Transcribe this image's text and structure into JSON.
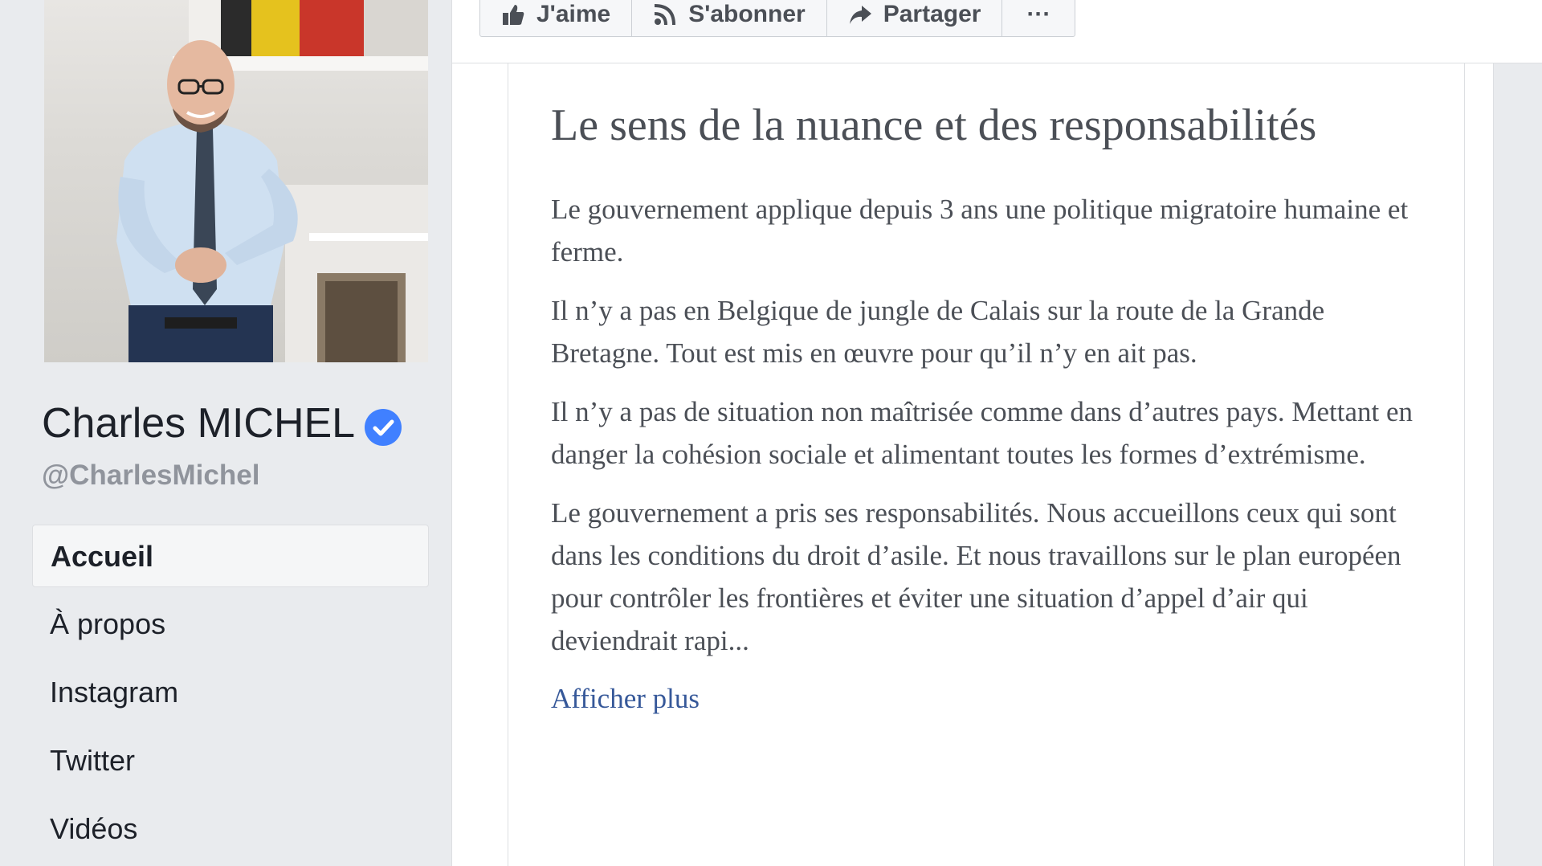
{
  "profile": {
    "name": "Charles MICHEL",
    "handle": "@CharlesMichel",
    "verified": true
  },
  "nav": {
    "items": [
      {
        "label": "Accueil",
        "active": true
      },
      {
        "label": "À propos",
        "active": false
      },
      {
        "label": "Instagram",
        "active": false
      },
      {
        "label": "Twitter",
        "active": false
      },
      {
        "label": "Vidéos",
        "active": false
      }
    ]
  },
  "actions": {
    "like_label": "J'aime",
    "subscribe_label": "S'abonner",
    "share_label": "Partager",
    "more_label": "···"
  },
  "article": {
    "title": "Le sens de la nuance et des responsabilités",
    "paragraphs": [
      "Le gouvernement applique depuis 3 ans une politique migratoire humaine et ferme.",
      "Il n’y a pas en Belgique de jungle de Calais sur la route de la Grande Bretagne. Tout est mis en œuvre pour qu’il n’y en ait pas.",
      "Il n’y a pas de situation non maîtrisée comme dans d’autres pays. Mettant en danger la cohésion sociale et alimentant toutes les formes d’extrémisme.",
      "Le gouvernement a pris ses responsabilités. Nous accueillons ceux qui sont dans les conditions du droit d’asile. Et nous travaillons sur le plan européen pour contrôler les frontières et éviter une situation d’appel d’air qui deviendrait rapi..."
    ],
    "see_more": "Afficher plus"
  },
  "colors": {
    "background": "#e9ebee",
    "verified_badge": "#4080ff",
    "link": "#365899",
    "text": "#4b4f56"
  },
  "icons": [
    "thumbs-up-icon",
    "rss-icon",
    "share-arrow-icon",
    "more-icon",
    "verified-badge-icon"
  ]
}
